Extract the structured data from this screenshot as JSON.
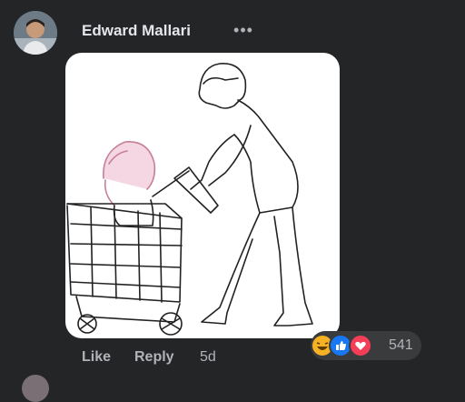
{
  "comment": {
    "author": "Edward Mallari",
    "more_label": "•••"
  },
  "actions": {
    "like_label": "Like",
    "reply_label": "Reply",
    "timestamp": "5d"
  },
  "reactions": {
    "icons": [
      "haha-icon",
      "like-icon",
      "love-icon"
    ],
    "count": "541"
  },
  "colors": {
    "background": "#242526",
    "text_primary": "#e4e6eb",
    "text_secondary": "#b0b3b8",
    "like_blue": "#1877f2",
    "love_red": "#f33e58",
    "haha_yellow": "#f7b125"
  }
}
